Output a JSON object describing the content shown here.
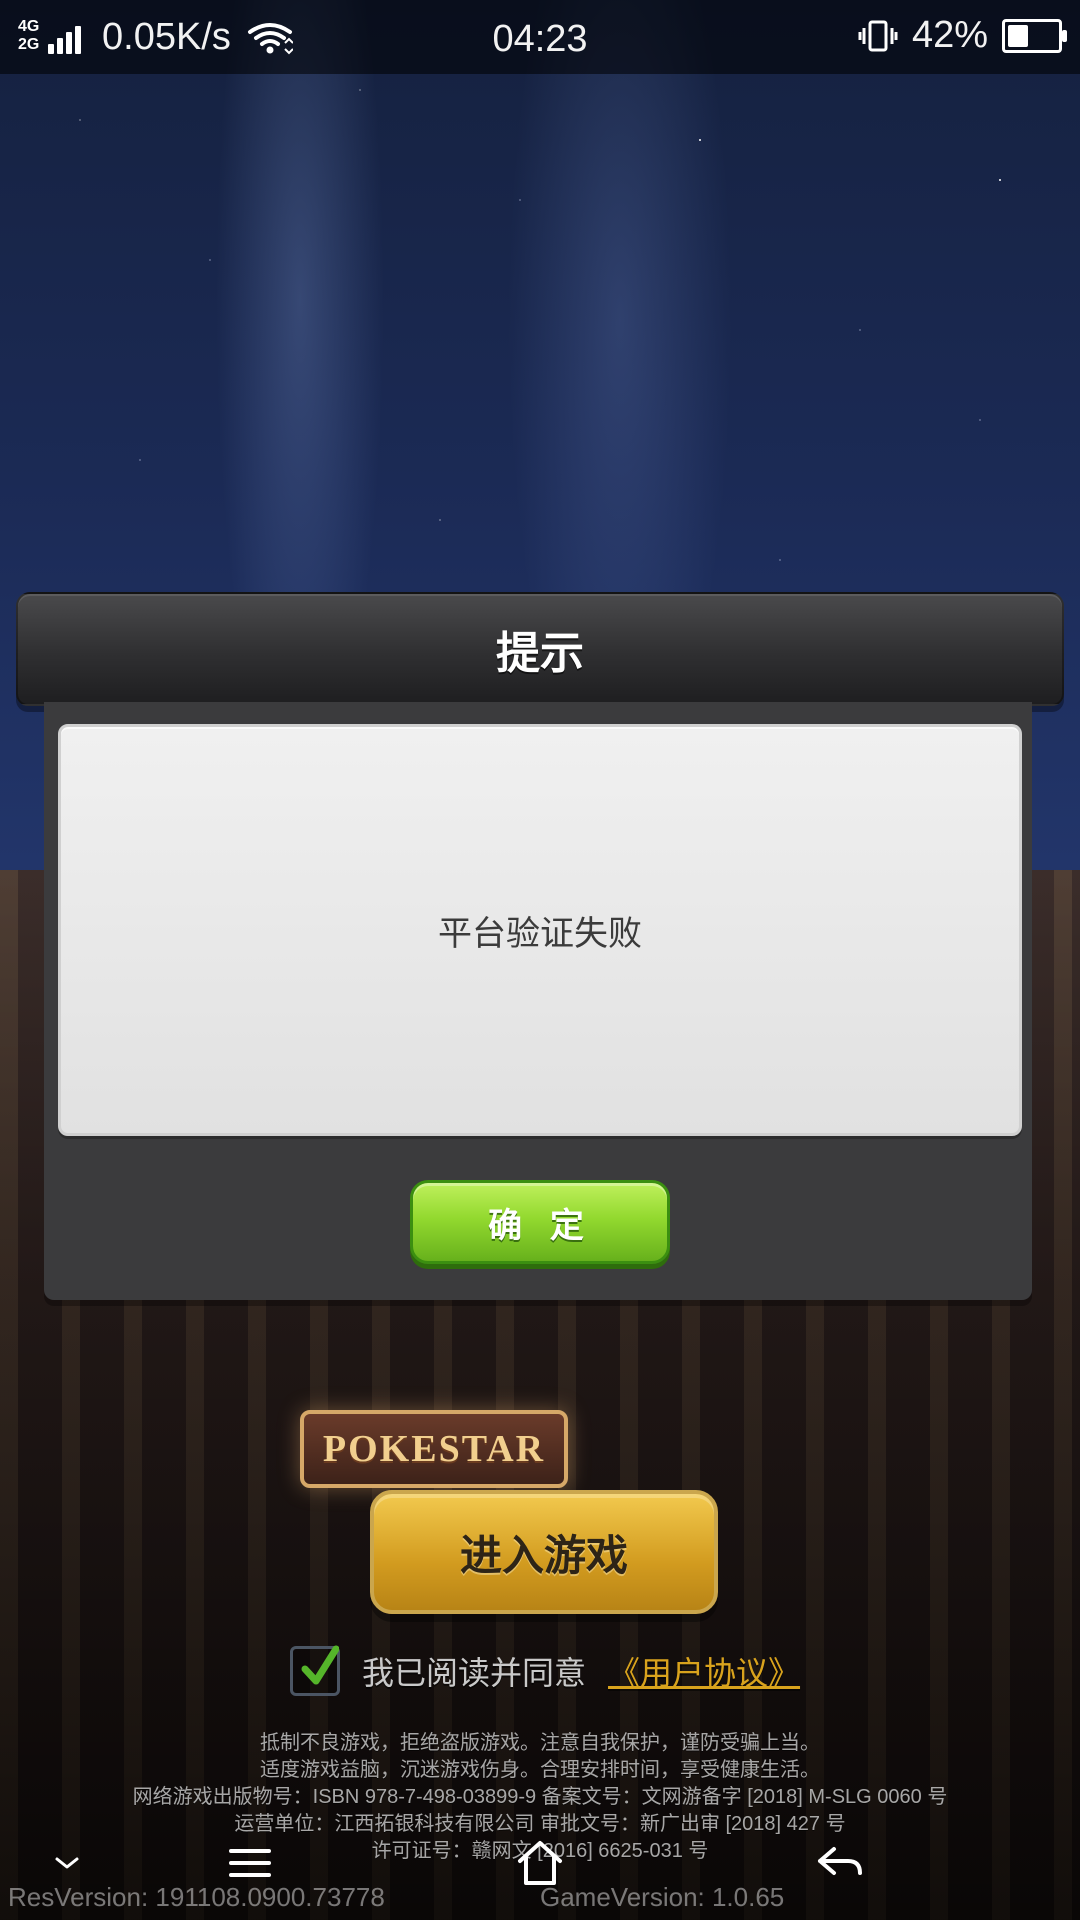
{
  "status_bar": {
    "network_top": "4G",
    "network_bottom": "2G",
    "speed": "0.05K/s",
    "time": "04:23",
    "battery_percent_text": "42%",
    "battery_level": 0.42
  },
  "dialog": {
    "title": "提示",
    "message": "平台验证失败",
    "confirm_label": "确 定"
  },
  "scene": {
    "marquee_text": "POKESTAR"
  },
  "enter_button": {
    "label": "进入游戏"
  },
  "agreement": {
    "text": "我已阅读并同意",
    "link": "《用户协议》",
    "checked": true
  },
  "legal": {
    "line1": "抵制不良游戏，拒绝盗版游戏。注意自我保护，谨防受骗上当。",
    "line2": "适度游戏益脑，沉迷游戏伤身。合理安排时间，享受健康生活。",
    "line3": "网络游戏出版物号：ISBN 978-7-498-03899-9  备案文号：文网游备字 [2018] M-SLG 0060 号",
    "line4": "运营单位：江西拓银科技有限公司      审批文号：新广出审 [2018] 427 号",
    "line5": "许可证号：赣网文 [2016] 6625-031 号"
  },
  "versions": {
    "res": "ResVersion:  191108.0900.73778",
    "game": "GameVersion: 1.0.65"
  },
  "colors": {
    "confirm_green": "#93d92f",
    "enter_gold": "#d29b1f",
    "link_gold": "#d9a31d",
    "dialog_dark": "#3b3b3d",
    "message_bg": "#e1e1e1"
  },
  "icons": {
    "signal": "signal-icon",
    "wifi": "wifi-icon",
    "vibrate": "vibrate-icon",
    "battery": "battery-icon",
    "checkmark": "checkmark-icon",
    "nav_collapse": "chevron-down-icon",
    "nav_menu": "menu-icon",
    "nav_home": "home-icon",
    "nav_back": "back-icon"
  }
}
